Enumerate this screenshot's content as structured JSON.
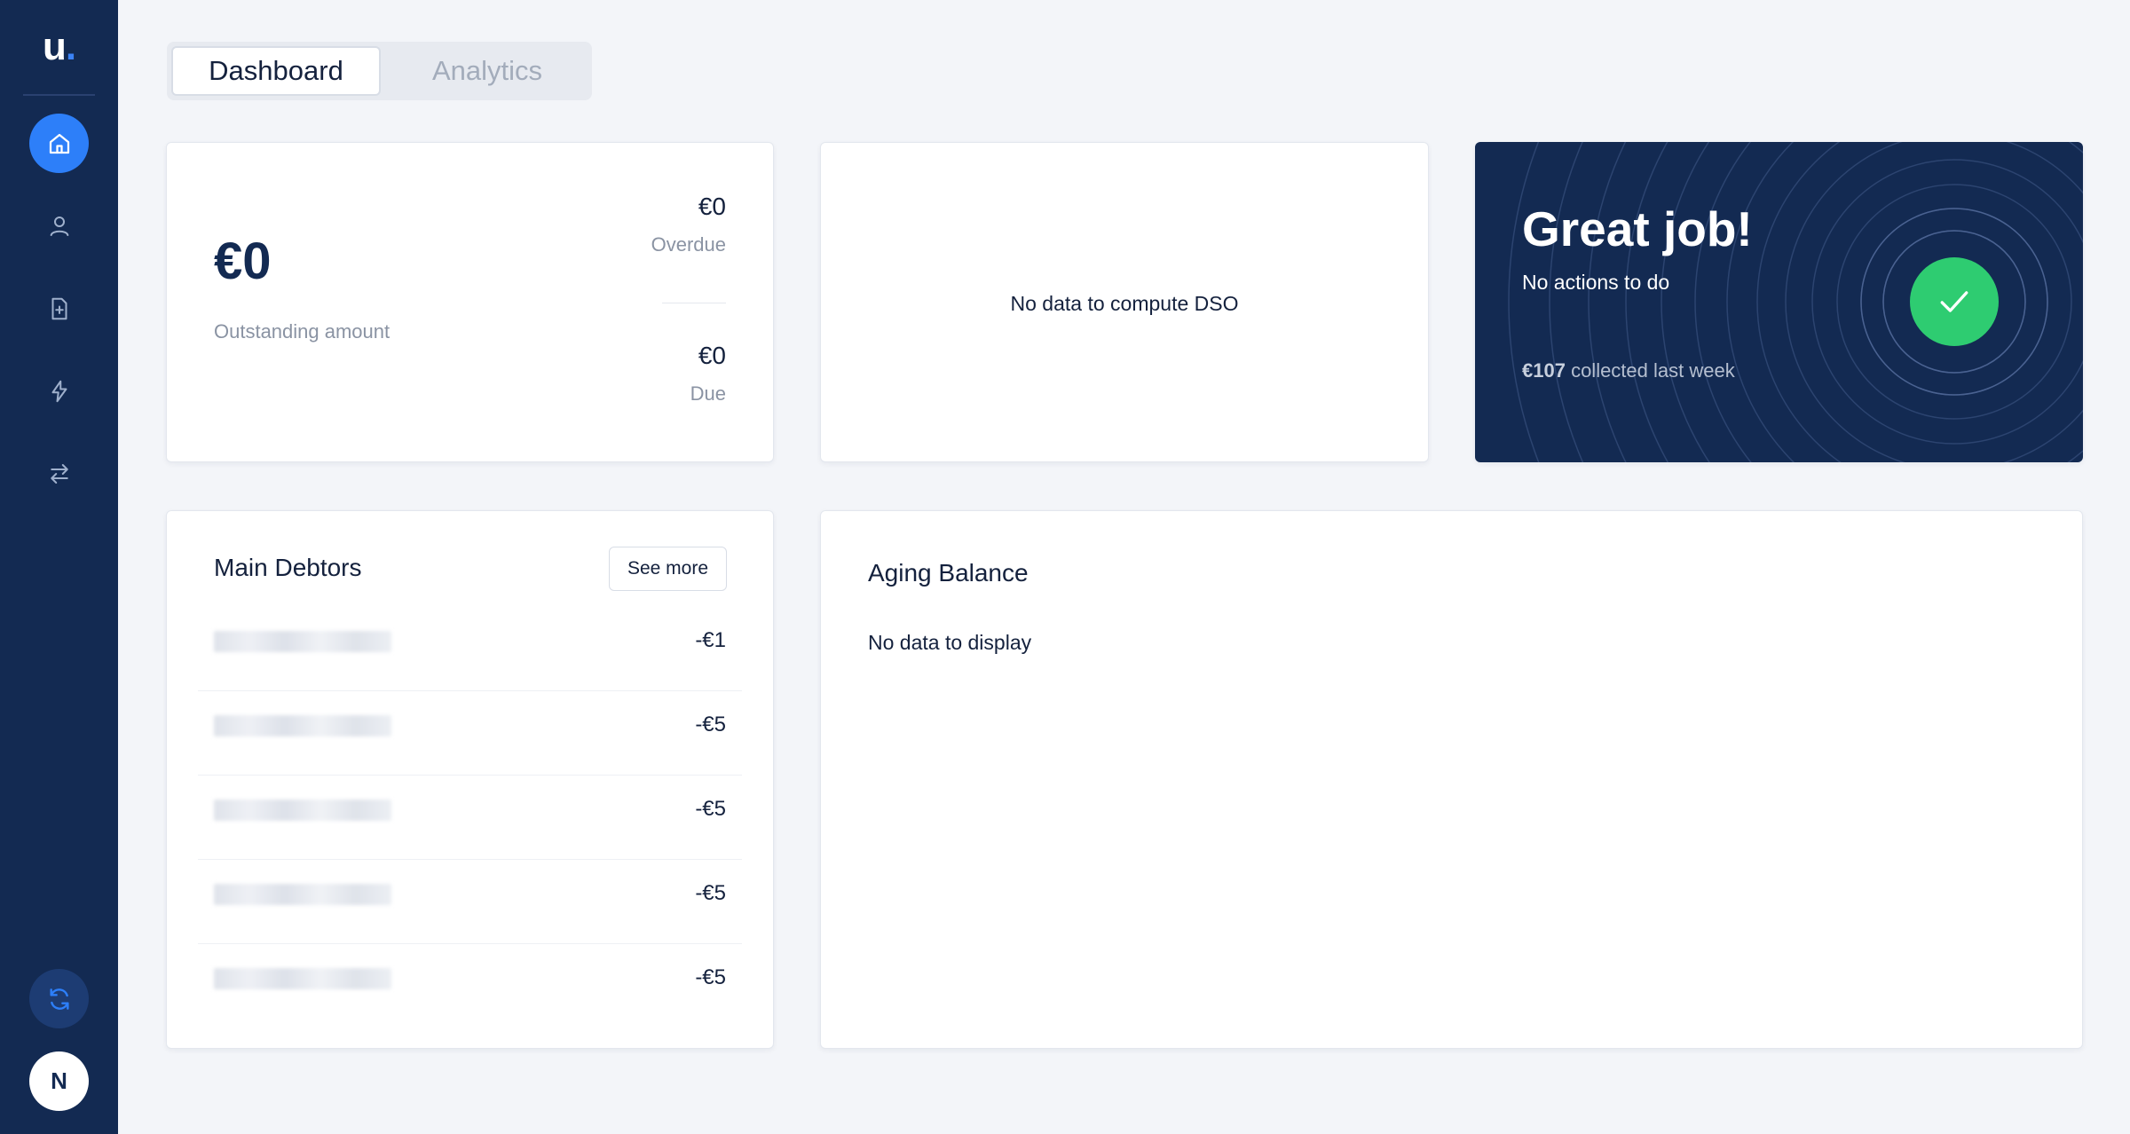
{
  "brand": {
    "logo_text": "u",
    "logo_dot": "."
  },
  "sidebar": {
    "items": [
      {
        "name": "home",
        "icon": "home-icon",
        "active": true
      },
      {
        "name": "customers",
        "icon": "user-icon",
        "active": false
      },
      {
        "name": "invoices",
        "icon": "document-icon",
        "active": false
      },
      {
        "name": "actions",
        "icon": "lightning-icon",
        "active": false
      },
      {
        "name": "transactions",
        "icon": "transfer-arrows-icon",
        "active": false
      }
    ],
    "sync_icon": "sync-icon",
    "avatar_initial": "N"
  },
  "tabs": [
    {
      "label": "Dashboard",
      "active": true
    },
    {
      "label": "Analytics",
      "active": false
    }
  ],
  "outstanding": {
    "amount": "€0",
    "label": "Outstanding amount",
    "overdue_value": "€0",
    "overdue_label": "Overdue",
    "due_value": "€0",
    "due_label": "Due"
  },
  "dso": {
    "message": "No data to compute DSO"
  },
  "great_job": {
    "title": "Great job!",
    "subtitle": "No actions to do",
    "collected_amount": "€107",
    "collected_text": " collected last week",
    "icon": "check-icon"
  },
  "debtors": {
    "title": "Main Debtors",
    "see_more": "See more",
    "rows": [
      {
        "amount": "-€1"
      },
      {
        "amount": "-€5"
      },
      {
        "amount": "-€5"
      },
      {
        "amount": "-€5"
      },
      {
        "amount": "-€5"
      }
    ]
  },
  "aging": {
    "title": "Aging Balance",
    "message": "No data to display"
  },
  "colors": {
    "sidebar_bg": "#132a52",
    "accent": "#2d7ff9",
    "success": "#2ecc71",
    "page_bg": "#f3f5f9"
  }
}
